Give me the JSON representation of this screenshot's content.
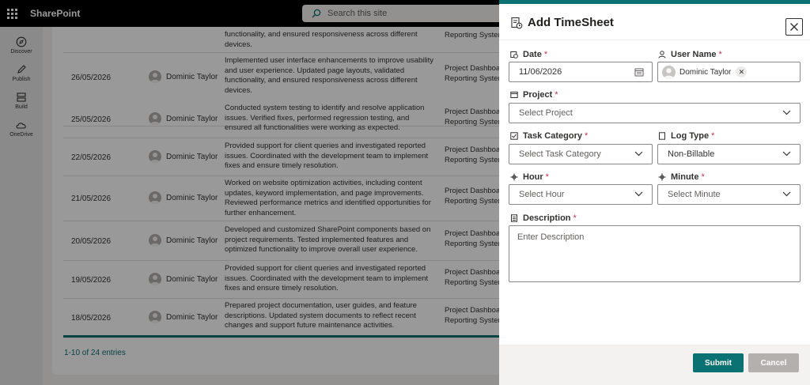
{
  "app": {
    "brand": "SharePoint",
    "search_placeholder": "Search this site"
  },
  "rail": [
    {
      "label": "Discover",
      "icon": "compass-icon"
    },
    {
      "label": "Publish",
      "icon": "pen-icon"
    },
    {
      "label": "Build",
      "icon": "build-icon"
    },
    {
      "label": "OneDrive",
      "icon": "cloud-icon"
    }
  ],
  "table": {
    "rows": [
      {
        "date": "",
        "user": "",
        "desc": "functionality, and ensured responsiveness across different devices.",
        "proj1": "Reporting Syster",
        "proj2": ""
      },
      {
        "date": "26/05/2026",
        "user": "Dominic Taylor",
        "desc": "Implemented user interface enhancements to improve usability and user experience. Updated page layouts, validated functionality, and ensured responsiveness across different devices.",
        "proj1": "Project Dashboa",
        "proj2": "Reporting Syster"
      },
      {
        "date": "25/05/2026",
        "user": "Dominic Taylor",
        "desc": "Conducted system testing to identify and resolve application issues. Verified fixes, performed regression testing, and ensured all functionalities were working as expected.",
        "proj1": "Project Dashboa",
        "proj2": "Reporting Syster"
      },
      {
        "date": "22/05/2026",
        "user": "Dominic Taylor",
        "desc": "Provided support for client queries and investigated reported issues. Coordinated with the development team to implement fixes and ensure timely resolution.",
        "proj1": "Project Dashboa",
        "proj2": "Reporting Syster"
      },
      {
        "date": "21/05/2026",
        "user": "Dominic Taylor",
        "desc": "Worked on website optimization activities, including content updates, keyword implementation, and page improvements. Reviewed performance metrics and identified opportunities for further enhancement.",
        "proj1": "Project Dashboa",
        "proj2": "Reporting Syster"
      },
      {
        "date": "20/05/2026",
        "user": "Dominic Taylor",
        "desc": "Developed and customized SharePoint components based on project requirements. Tested implemented features and optimized functionality to improve overall user experience.",
        "proj1": "Project Dashboa",
        "proj2": "Reporting Syster"
      },
      {
        "date": "19/05/2026",
        "user": "Dominic Taylor",
        "desc": "Provided support for client queries and investigated reported issues. Coordinated with the development team to implement fixes and ensure timely resolution.",
        "proj1": "Project Dashboa",
        "proj2": "Reporting Syster"
      },
      {
        "date": "18/05/2026",
        "user": "Dominic Taylor",
        "desc": "Prepared project documentation, user guides, and feature descriptions. Updated system documents to reflect recent changes and support future maintenance activities.",
        "proj1": "Project Dashboa",
        "proj2": "Reporting Syster"
      }
    ],
    "entries": "1-10 of 24 entries"
  },
  "panel": {
    "title": "Add TimeSheet",
    "date_label": "Date",
    "date_value": "11/06/2026",
    "username_label": "User Name",
    "username_value": "Dominic Taylor",
    "project_label": "Project",
    "project_placeholder": "Select Project",
    "task_label": "Task Category",
    "task_placeholder": "Select Task Category",
    "logtype_label": "Log Type",
    "logtype_value": "Non-Billable",
    "hour_label": "Hour",
    "hour_placeholder": "Select Hour",
    "minute_label": "Minute",
    "minute_placeholder": "Select Minute",
    "desc_label": "Description",
    "desc_placeholder": "Enter Description",
    "required_mark": "*",
    "submit_label": "Submit",
    "cancel_label": "Cancel",
    "accent_color": "#0a7272"
  }
}
